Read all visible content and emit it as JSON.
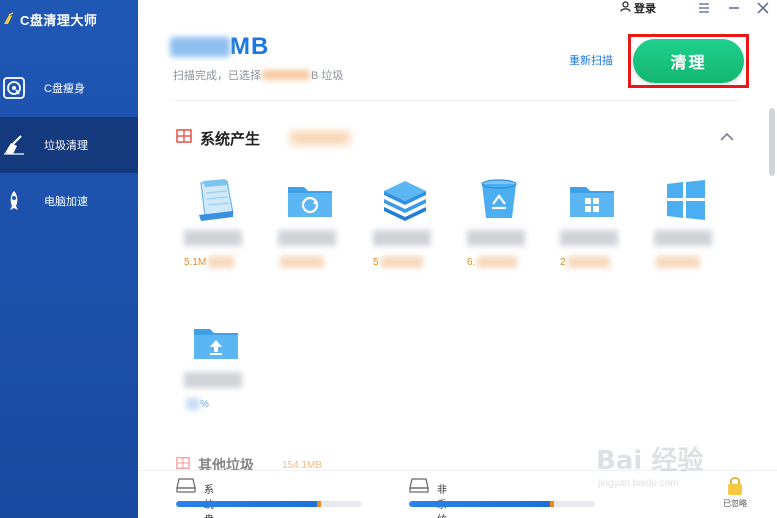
{
  "app": {
    "title": "C盘清理大师"
  },
  "sidebar": {
    "items": [
      {
        "label": "C盘瘦身",
        "icon": "disk-slim-icon"
      },
      {
        "label": "垃圾清理",
        "icon": "broom-icon",
        "active": true
      },
      {
        "label": "电脑加速",
        "icon": "rocket-icon"
      }
    ]
  },
  "titlebar": {
    "login_label": "登录"
  },
  "summary": {
    "size_suffix": "MB",
    "text_prefix": "扫描完成，已选择",
    "text_suffix": "B 垃圾"
  },
  "actions": {
    "rescan_label": "重新扫描",
    "clean_label": "清理"
  },
  "section": {
    "title": "系统产生",
    "tiles": [
      {
        "icon": "notepad-icon",
        "size_hint": "5.1M"
      },
      {
        "icon": "folder-sync-icon",
        "size_hint": ""
      },
      {
        "icon": "layers-icon",
        "size_hint": "5"
      },
      {
        "icon": "recycle-bin-icon",
        "size_hint": "6."
      },
      {
        "icon": "folder-windows-icon",
        "size_hint": "2"
      },
      {
        "icon": "windows-icon",
        "size_hint": ""
      },
      {
        "icon": "folder-upload-icon",
        "size_hint": "%"
      }
    ]
  },
  "section2": {
    "title": "其他垃圾",
    "size": "154.1MB"
  },
  "footer": {
    "system_disk_label": "系统盘",
    "system_disk_usage": 0.78,
    "nonsystem_disk_label": "非系统盘",
    "nonsystem_disk_usage": 0.78,
    "unlock_label": "已忽略"
  },
  "watermark": {
    "brand": "Bai 经验",
    "url": "jingyan.baidu.com"
  },
  "colors": {
    "sidebar": "#1f57b5",
    "sidebar_active": "#15397d",
    "accent_blue": "#1b78e3",
    "clean_green": "#13b66f",
    "highlight_red": "#e81818"
  }
}
